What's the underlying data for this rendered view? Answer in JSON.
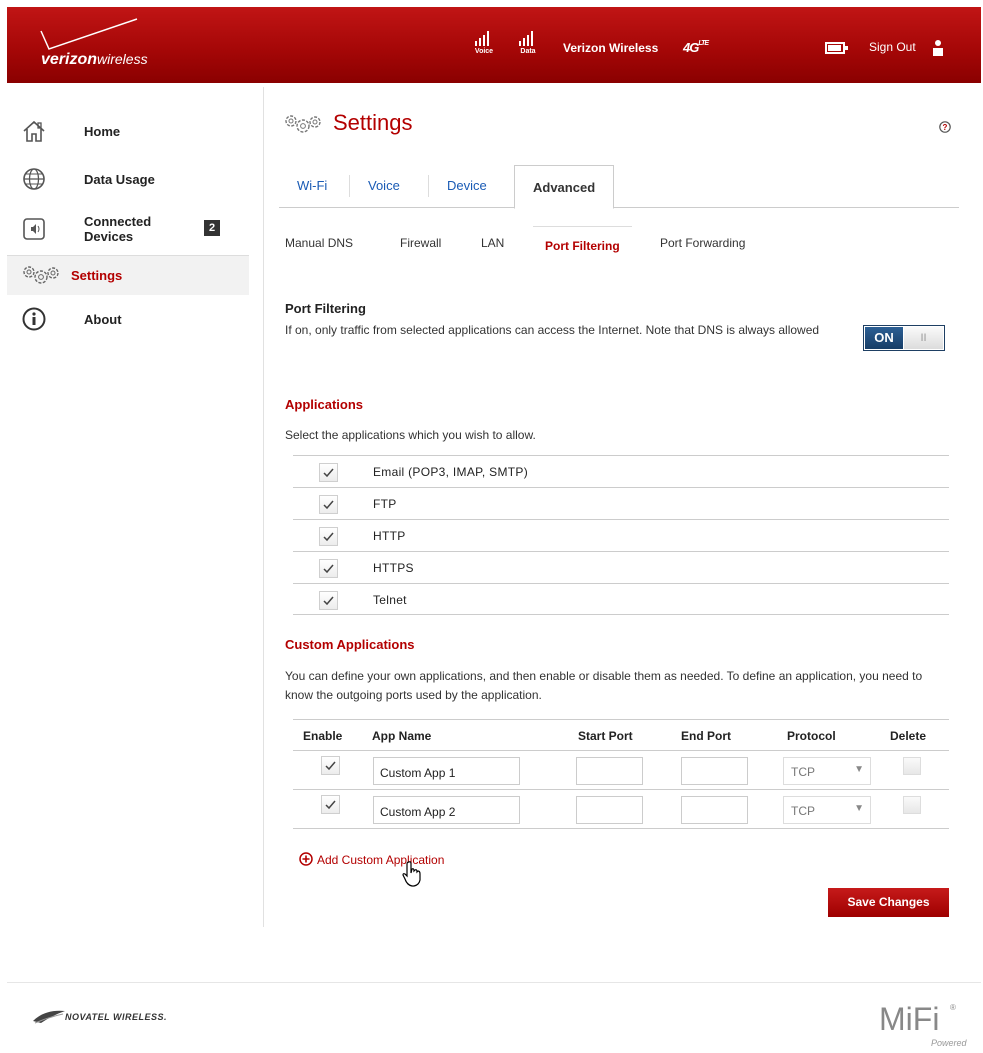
{
  "header": {
    "logo_brand": "verizon",
    "logo_suffix": "wireless",
    "voice_label": "Voice",
    "data_label": "Data",
    "carrier": "Verizon Wireless",
    "network": "4G",
    "network_suffix": "LTE",
    "battery_level": 0.9,
    "sign_out": "Sign Out"
  },
  "sidebar": {
    "items": [
      {
        "label": "Home",
        "icon": "home-icon"
      },
      {
        "label": "Data Usage",
        "icon": "globe-icon"
      },
      {
        "label": "Connected\nDevices",
        "icon": "connected-devices-icon",
        "badge": "2"
      },
      {
        "label": "Settings",
        "icon": "gears-icon",
        "active": true
      },
      {
        "label": "About",
        "icon": "info-icon"
      }
    ]
  },
  "main": {
    "title": "Settings",
    "tabs": [
      "Wi-Fi",
      "Voice",
      "Device",
      "Advanced"
    ],
    "subtabs": [
      "Manual DNS",
      "Firewall",
      "LAN",
      "Port Filtering",
      "Port Forwarding"
    ],
    "port_filtering": {
      "heading": "Port Filtering",
      "description": "If on, only traffic from selected applications can access the Internet. Note that DNS is always allowed",
      "toggle_on": "ON",
      "toggle_knob": "II"
    },
    "applications": {
      "heading": "Applications",
      "description": "Select the applications which you wish to allow.",
      "items": [
        "Email (POP3, IMAP, SMTP)",
        "FTP",
        "HTTP",
        "HTTPS",
        "Telnet"
      ]
    },
    "custom": {
      "heading": "Custom Applications",
      "description": "You can define your own applications, and then enable or disable them as needed. To define an application, you need to know the outgoing ports used by the application.",
      "columns": [
        "Enable",
        "App Name",
        "Start Port",
        "End Port",
        "Protocol",
        "Delete"
      ],
      "rows": [
        {
          "name": "Custom App 1",
          "start": "",
          "end": "",
          "protocol": "TCP"
        },
        {
          "name": "Custom App 2",
          "start": "",
          "end": "",
          "protocol": "TCP"
        }
      ],
      "add_label": "Add Custom Application",
      "save_label": "Save Changes"
    }
  },
  "footer": {
    "novatel": "NOVATEL WIRELESS.",
    "mifi": "MiFi",
    "mifi_sup": "®",
    "powered": "Powered"
  }
}
